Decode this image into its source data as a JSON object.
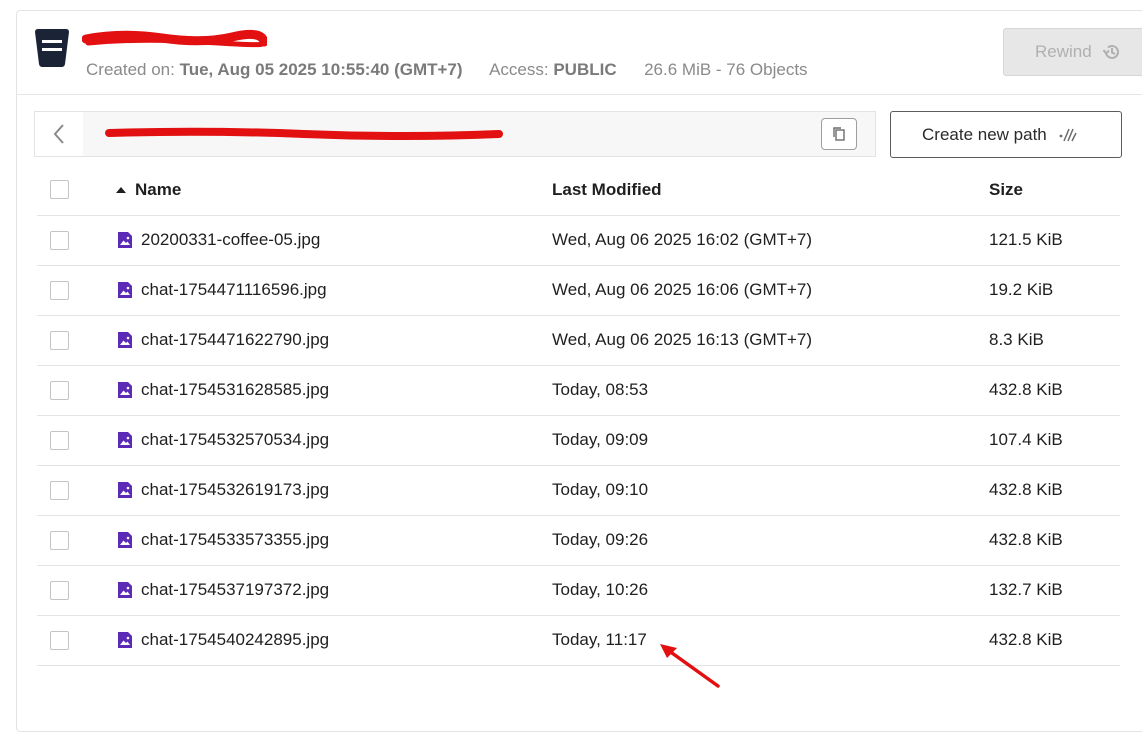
{
  "bucket": {
    "icon": "bucket-icon",
    "created_label": "Created on:",
    "created_value": "Tue, Aug 05 2025 10:55:40 (GMT+7)",
    "access_label": "Access:",
    "access_value": "PUBLIC",
    "usage": "26.6 MiB - 76 Objects"
  },
  "toolbar": {
    "rewind_label": "Rewind",
    "rewind_icon": "history-icon",
    "create_path_label": "Create new path",
    "create_path_icon": "new-path-icon",
    "copy_icon": "copy-icon",
    "back_icon": "chevron-left-icon"
  },
  "table": {
    "columns": [
      "Name",
      "Last Modified",
      "Size"
    ],
    "sort_icon": "sort-asc-icon",
    "rows": [
      {
        "name": "20200331-coffee-05.jpg",
        "modified": "Wed, Aug 06 2025 16:02 (GMT+7)",
        "size": "121.5 KiB"
      },
      {
        "name": "chat-1754471116596.jpg",
        "modified": "Wed, Aug 06 2025 16:06 (GMT+7)",
        "size": "19.2 KiB"
      },
      {
        "name": "chat-1754471622790.jpg",
        "modified": "Wed, Aug 06 2025 16:13 (GMT+7)",
        "size": "8.3 KiB"
      },
      {
        "name": "chat-1754531628585.jpg",
        "modified": "Today, 08:53",
        "size": "432.8 KiB"
      },
      {
        "name": "chat-1754532570534.jpg",
        "modified": "Today, 09:09",
        "size": "107.4 KiB"
      },
      {
        "name": "chat-1754532619173.jpg",
        "modified": "Today, 09:10",
        "size": "432.8 KiB"
      },
      {
        "name": "chat-1754533573355.jpg",
        "modified": "Today, 09:26",
        "size": "432.8 KiB"
      },
      {
        "name": "chat-1754537197372.jpg",
        "modified": "Today, 10:26",
        "size": "132.7 KiB"
      },
      {
        "name": "chat-1754540242895.jpg",
        "modified": "Today, 11:17",
        "size": "432.8 KiB"
      }
    ]
  },
  "colors": {
    "file_icon": "#5b2bb5",
    "redaction": "#e21010",
    "bucket_icon": "#1b2436",
    "annotation_arrow": "#e21010"
  }
}
